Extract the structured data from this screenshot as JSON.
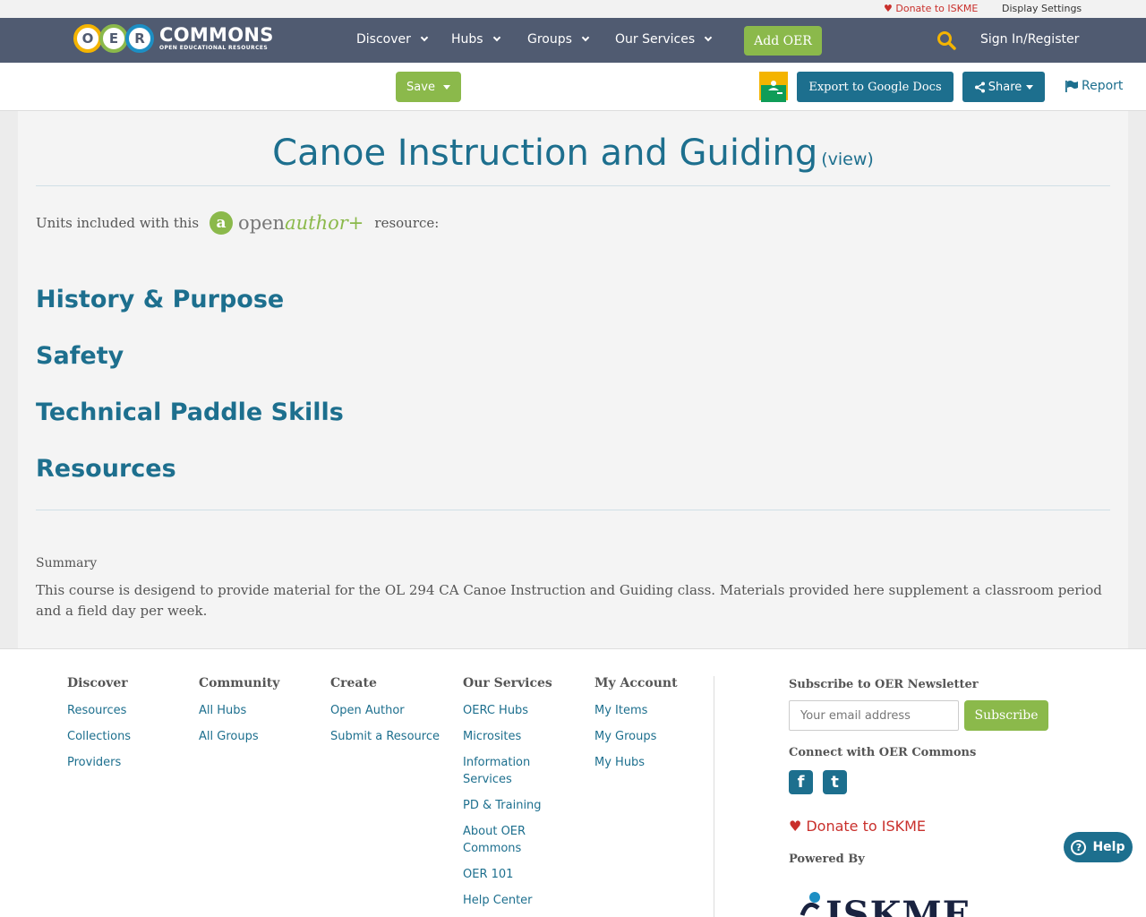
{
  "utility": {
    "donate": "Donate to ISKME",
    "display_settings": "Display Settings"
  },
  "nav": {
    "logo_letters": [
      "O",
      "E",
      "R"
    ],
    "logo_title": "COMMONS",
    "logo_subtitle": "OPEN EDUCATIONAL RESOURCES",
    "items": [
      {
        "label": "Discover"
      },
      {
        "label": "Hubs"
      },
      {
        "label": "Groups"
      },
      {
        "label": "Our Services"
      }
    ],
    "add_oer": "Add OER",
    "signin": "Sign In/Register"
  },
  "toolbar": {
    "save": "Save",
    "export": "Export to Google Docs",
    "share": "Share",
    "report": "Report"
  },
  "content": {
    "title": "Canoe Instruction and Guiding",
    "view_link": "(view)",
    "units_prefix": "Units included with this",
    "openauthor_a": "a",
    "openauthor_open": "open",
    "openauthor_author": "author",
    "openauthor_plus": "+",
    "units_suffix": "resource:",
    "sections": [
      "History & Purpose",
      "Safety",
      "Technical Paddle Skills",
      "Resources"
    ],
    "summary_label": "Summary",
    "summary_text": "This course is desigend to provide material for the OL 294 CA Canoe Instruction and Guiding class. Materials provided here supplement a classroom period and a field day per week."
  },
  "footer": {
    "columns": [
      {
        "heading": "Discover",
        "links": [
          "Resources",
          "Collections",
          "Providers"
        ]
      },
      {
        "heading": "Community",
        "links": [
          "All Hubs",
          "All Groups"
        ]
      },
      {
        "heading": "Create",
        "links": [
          "Open Author",
          "Submit a Resource"
        ]
      },
      {
        "heading": "Our Services",
        "links": [
          "OERC Hubs",
          "Microsites",
          "Information Services",
          "PD & Training",
          "About OER Commons",
          "OER 101",
          "Help Center"
        ]
      },
      {
        "heading": "My Account",
        "links": [
          "My Items",
          "My Groups",
          "My Hubs"
        ]
      }
    ],
    "subscribe_heading": "Subscribe to OER Newsletter",
    "email_placeholder": "Your email address",
    "subscribe_button": "Subscribe",
    "connect_heading": "Connect with OER Commons",
    "facebook_glyph": "f",
    "twitter_glyph": "t",
    "donate": "Donate to ISKME",
    "powered_by": "Powered By",
    "iskme_logo_text": "ISKME"
  },
  "help": {
    "label": "Help",
    "glyph": "?"
  },
  "colors": {
    "nav_bg": "#505b71",
    "accent_teal": "#1d6f8e",
    "accent_green": "#8bb94b",
    "donate_red": "#c9302c",
    "logo_o": "#f4b400",
    "logo_e": "#8bb94b",
    "logo_r": "#1d8fc4"
  },
  "icons": [
    "heart-icon",
    "search-icon",
    "chevron-down-icon",
    "google-classroom-icon",
    "share-icon",
    "flag-icon",
    "facebook-icon",
    "twitter-icon",
    "help-icon"
  ]
}
